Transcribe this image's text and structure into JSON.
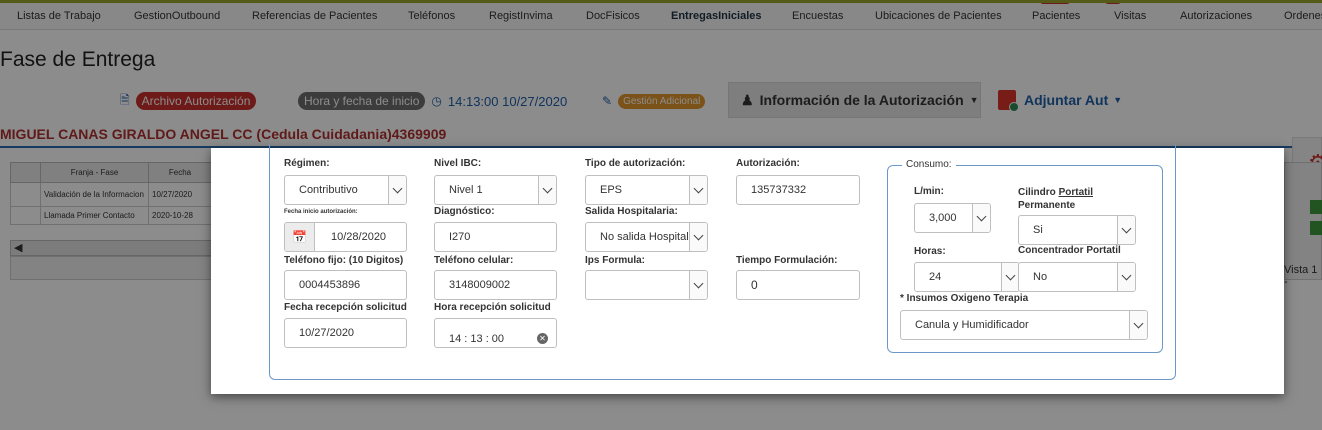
{
  "nav": {
    "items": [
      "Listas de Trabajo",
      "GestionOutbound",
      "Referencias de Pacientes",
      "Teléfonos",
      "RegistInvima",
      "DocFisicos",
      "EntregasIniciales",
      "Encuestas",
      "Ubicaciones de Pacientes",
      "Pacientes",
      "Visitas",
      "Autorizaciones",
      "Ordenes"
    ],
    "active": "EntregasIniciales"
  },
  "page": {
    "title": "Fase de Entrega",
    "archivo_label": "Archivo Autorización",
    "hora_fecha_label": "Hora y fecha de inicio",
    "start_time": "14:13:00 10/27/2020",
    "gestion_label": "Gestión Adicional",
    "auth_info_label": "Información de la Autorización",
    "adjuntar_label": "Adjuntar Aut",
    "patient": "MIGUEL CANAS GIRALDO ANGEL CC (Cedula Cuidadania)4369909",
    "vista": "Vista 1 -"
  },
  "bg_table": {
    "headers": [
      "Franja - Fase",
      "Fecha"
    ],
    "rows": [
      [
        "Validación de la Informacion",
        "10/27/2020"
      ],
      [
        "Llamada Primer Contacto",
        "2020-10-28"
      ]
    ]
  },
  "form": {
    "regimen": {
      "label": "Régimen:",
      "value": "Contributivo"
    },
    "nivel_ibc": {
      "label": "Nivel IBC:",
      "value": "Nivel 1"
    },
    "tipo_autorizacion": {
      "label": "Tipo de autorización:",
      "value": "EPS"
    },
    "autorizacion": {
      "label": "Autorización:",
      "value": "135737332"
    },
    "fecha_inicio_aut": {
      "label": "Fecha inicio autorización:",
      "value": "10/28/2020"
    },
    "diagnostico": {
      "label": "Diagnóstico:",
      "value": "I270"
    },
    "salida_hospitalaria": {
      "label": "Salida Hospitalaria:",
      "value": "No salida Hospitalaria"
    },
    "telefono_fijo": {
      "label": "Teléfono fijo: (10 Digitos)",
      "value": "0004453896"
    },
    "telefono_celular": {
      "label": "Teléfono celular:",
      "value": "3148009002"
    },
    "ips_formula": {
      "label": "Ips Formula:",
      "value": ""
    },
    "tiempo_formulacion": {
      "label": "Tiempo Formulación:",
      "value": "0"
    },
    "fecha_recepcion": {
      "label": "Fecha recepción solicitud",
      "value": "10/27/2020"
    },
    "hora_recepcion": {
      "label": "Hora recepción solicitud",
      "value": "14 : 13 : 00"
    }
  },
  "consumo": {
    "legend": "Consumo:",
    "lmin": {
      "label": "L/min:",
      "value": "3,000"
    },
    "cilindro_prefix": "Cilindro ",
    "cilindro_underlined": "Portatil",
    "cilindro_suffix": "Permanente",
    "cilindro_value": "Si",
    "horas": {
      "label": "Horas:",
      "value": "24"
    },
    "concentrador": {
      "label": "Concentrador Portatil",
      "value": "No"
    },
    "insumos": {
      "label": "* Insumos Oxigeno Terapia",
      "value": "Canula y Humidificador"
    }
  }
}
